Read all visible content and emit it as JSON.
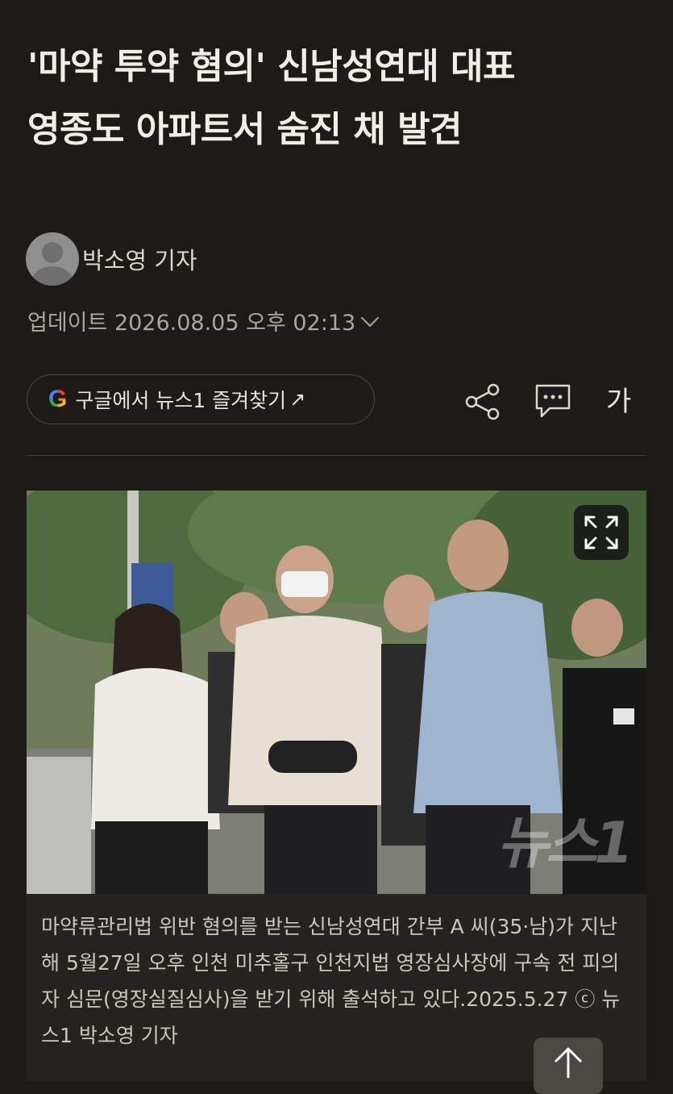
{
  "article": {
    "headline_line1": "'마약 투약 혐의' 신남성연대 대표",
    "headline_line2": "영종도 아파트서 숨진 채 발견",
    "reporter": "박소영 기자",
    "update_label": "업데이트 2026.08.05 오후 02:13"
  },
  "toolbar": {
    "google_logo": "G",
    "google_button_label": "구글에서 뉴스1 즐겨찾기",
    "google_button_arrow": "↗",
    "font_size_label": "가",
    "icons": [
      "share-icon",
      "comment-icon"
    ]
  },
  "photo": {
    "watermark": "뉴스1",
    "caption": "마약류관리법 위반 혐의를 받는 신남성연대 간부 A 씨(35·남)가 지난해 5월27일 오후 인천 미추홀구 인천지법 영장심사장에 구속 전 피의자 심문(영장실질심사)을 받기 위해 출석하고 있다.2025.5.27 ⓒ 뉴스1 박소영 기자"
  },
  "colors": {
    "background": "#1d1b17",
    "text": "#f0eee8",
    "muted": "#a9a7a0",
    "caption_bg": "#25231f"
  }
}
